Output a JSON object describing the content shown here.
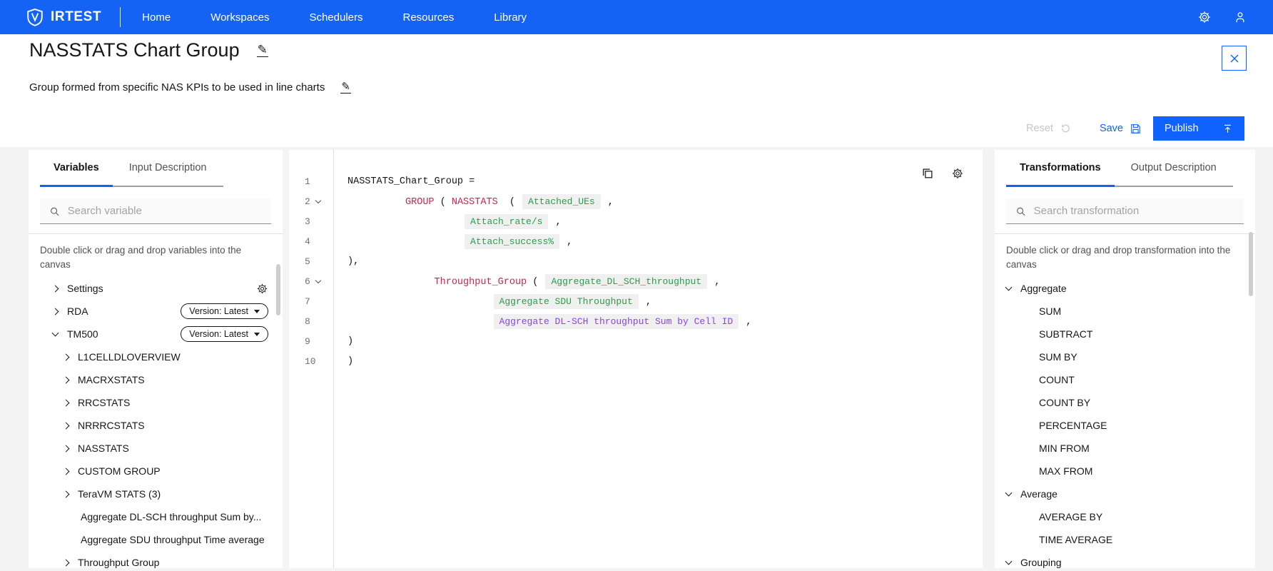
{
  "colors": {
    "navbar": "#1563f5",
    "accent": "#0f62fe",
    "keyword": "#d6224a",
    "green": "#24a148",
    "purple": "#8a3ffc",
    "pill_bg": "#f0f0f0"
  },
  "navbar": {
    "logo_text": "IRTEST",
    "items": [
      {
        "label": "Home"
      },
      {
        "label": "Workspaces"
      },
      {
        "label": "Schedulers"
      },
      {
        "label": "Resources"
      },
      {
        "label": "Library"
      }
    ],
    "icons": [
      "settings-gear-icon",
      "user-profile-icon"
    ]
  },
  "header": {
    "title": "NASSTATS Chart Group",
    "subtitle": "Group formed from specific NAS KPIs to be used in line charts"
  },
  "actions": {
    "reset": "Reset",
    "save": "Save",
    "publish": "Publish"
  },
  "variables_panel": {
    "tabs": [
      {
        "label": "Variables"
      },
      {
        "label": "Input Description"
      }
    ],
    "search_placeholder": "Search variable",
    "hint": "Double click or drag and drop variables into the canvas",
    "tree": [
      {
        "label": "Settings",
        "chevron": "right",
        "gear": true
      },
      {
        "label": "RDA",
        "chevron": "right",
        "version": "Version: Latest"
      },
      {
        "label": "TM500",
        "chevron": "down",
        "version": "Version: Latest"
      },
      {
        "label": "L1CELLDLOVERVIEW",
        "chevron": "right",
        "level": 1
      },
      {
        "label": "MACRXSTATS",
        "chevron": "right",
        "level": 1
      },
      {
        "label": "RRCSTATS",
        "chevron": "right",
        "level": 1
      },
      {
        "label": "NRRRCSTATS",
        "chevron": "right",
        "level": 1
      },
      {
        "label": "NASSTATS",
        "chevron": "right",
        "level": 1
      },
      {
        "label": "CUSTOM GROUP",
        "chevron": "right",
        "level": 1
      },
      {
        "label": "TeraVM STATS (3)",
        "chevron": "right",
        "level": 1
      },
      {
        "label": "Aggregate DL-SCH throughput Sum by...",
        "chevron": "none",
        "level": 1
      },
      {
        "label": "Aggregate SDU throughput Time average",
        "chevron": "none",
        "level": 1
      },
      {
        "label": "Throughput Group",
        "chevron": "right",
        "level": 1
      }
    ]
  },
  "editor": {
    "lines": [
      {
        "num": "1",
        "text": "NASSTATS_Chart_Group ="
      },
      {
        "num": "2",
        "fold": true,
        "k1": "GROUP",
        "t1": " ( ",
        "k2": "NASSTATS",
        "t2": "  ( ",
        "pill": "Attached_UEs",
        "suffix": " ,",
        "pill_color": "#24a148"
      },
      {
        "num": "3",
        "indent": "                    ",
        "pill": "Attach_rate/s",
        "suffix": " ,",
        "pill_color": "#24a148"
      },
      {
        "num": "4",
        "indent": "                    ",
        "pill": "Attach_success%",
        "suffix": " ,",
        "pill_color": "#24a148"
      },
      {
        "num": "5",
        "text": "),"
      },
      {
        "num": "6",
        "fold": true,
        "t1": "     ",
        "k1": "Throughput_Group",
        "t2": " ( ",
        "pill": "Aggregate_DL_SCH_throughput",
        "suffix": " ,",
        "pill_color": "#24a148"
      },
      {
        "num": "7",
        "indent": "                         ",
        "pill": "Aggregate SDU Throughput",
        "suffix": " ,",
        "pill_color": "#24a148"
      },
      {
        "num": "8",
        "indent": "                         ",
        "pill": "Aggregate DL-SCH throughput Sum by Cell ID",
        "suffix": " ,",
        "pill_color": "#8a3ffc"
      },
      {
        "num": "9",
        "text": ")"
      },
      {
        "num": "10",
        "text": ")"
      }
    ]
  },
  "transformations_panel": {
    "tabs": [
      {
        "label": "Transformations"
      },
      {
        "label": "Output Description"
      }
    ],
    "search_placeholder": "Search transformation",
    "hint": "Double click or drag and drop transformation into the canvas",
    "items": [
      {
        "label": "Aggregate",
        "type": "group"
      },
      {
        "label": "SUM",
        "type": "item"
      },
      {
        "label": "SUBTRACT",
        "type": "item"
      },
      {
        "label": "SUM BY",
        "type": "item"
      },
      {
        "label": "COUNT",
        "type": "item"
      },
      {
        "label": "COUNT BY",
        "type": "item"
      },
      {
        "label": "PERCENTAGE",
        "type": "item"
      },
      {
        "label": "MIN FROM",
        "type": "item"
      },
      {
        "label": "MAX FROM",
        "type": "item"
      },
      {
        "label": "Average",
        "type": "group"
      },
      {
        "label": "AVERAGE BY",
        "type": "item"
      },
      {
        "label": "TIME AVERAGE",
        "type": "item"
      },
      {
        "label": "Grouping",
        "type": "group"
      }
    ]
  }
}
